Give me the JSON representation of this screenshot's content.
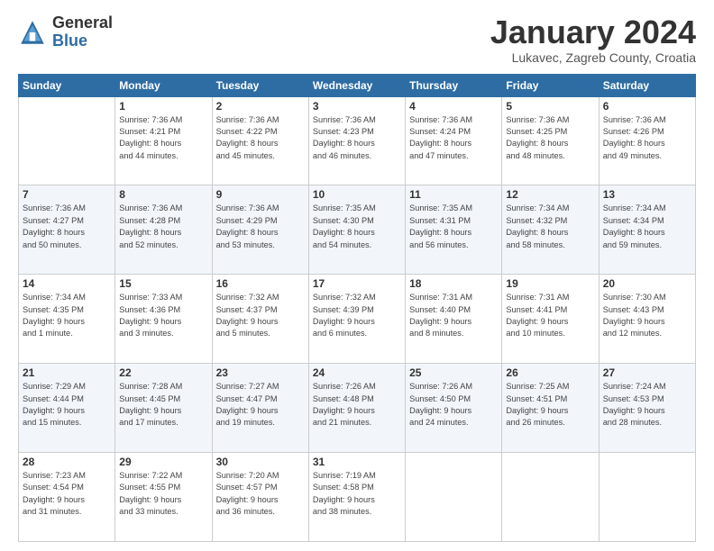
{
  "header": {
    "logo_general": "General",
    "logo_blue": "Blue",
    "month": "January 2024",
    "location": "Lukavec, Zagreb County, Croatia"
  },
  "weekdays": [
    "Sunday",
    "Monday",
    "Tuesday",
    "Wednesday",
    "Thursday",
    "Friday",
    "Saturday"
  ],
  "weeks": [
    [
      {
        "day": "",
        "info": ""
      },
      {
        "day": "1",
        "info": "Sunrise: 7:36 AM\nSunset: 4:21 PM\nDaylight: 8 hours\nand 44 minutes."
      },
      {
        "day": "2",
        "info": "Sunrise: 7:36 AM\nSunset: 4:22 PM\nDaylight: 8 hours\nand 45 minutes."
      },
      {
        "day": "3",
        "info": "Sunrise: 7:36 AM\nSunset: 4:23 PM\nDaylight: 8 hours\nand 46 minutes."
      },
      {
        "day": "4",
        "info": "Sunrise: 7:36 AM\nSunset: 4:24 PM\nDaylight: 8 hours\nand 47 minutes."
      },
      {
        "day": "5",
        "info": "Sunrise: 7:36 AM\nSunset: 4:25 PM\nDaylight: 8 hours\nand 48 minutes."
      },
      {
        "day": "6",
        "info": "Sunrise: 7:36 AM\nSunset: 4:26 PM\nDaylight: 8 hours\nand 49 minutes."
      }
    ],
    [
      {
        "day": "7",
        "info": "Sunrise: 7:36 AM\nSunset: 4:27 PM\nDaylight: 8 hours\nand 50 minutes."
      },
      {
        "day": "8",
        "info": "Sunrise: 7:36 AM\nSunset: 4:28 PM\nDaylight: 8 hours\nand 52 minutes."
      },
      {
        "day": "9",
        "info": "Sunrise: 7:36 AM\nSunset: 4:29 PM\nDaylight: 8 hours\nand 53 minutes."
      },
      {
        "day": "10",
        "info": "Sunrise: 7:35 AM\nSunset: 4:30 PM\nDaylight: 8 hours\nand 54 minutes."
      },
      {
        "day": "11",
        "info": "Sunrise: 7:35 AM\nSunset: 4:31 PM\nDaylight: 8 hours\nand 56 minutes."
      },
      {
        "day": "12",
        "info": "Sunrise: 7:34 AM\nSunset: 4:32 PM\nDaylight: 8 hours\nand 58 minutes."
      },
      {
        "day": "13",
        "info": "Sunrise: 7:34 AM\nSunset: 4:34 PM\nDaylight: 8 hours\nand 59 minutes."
      }
    ],
    [
      {
        "day": "14",
        "info": "Sunrise: 7:34 AM\nSunset: 4:35 PM\nDaylight: 9 hours\nand 1 minute."
      },
      {
        "day": "15",
        "info": "Sunrise: 7:33 AM\nSunset: 4:36 PM\nDaylight: 9 hours\nand 3 minutes."
      },
      {
        "day": "16",
        "info": "Sunrise: 7:32 AM\nSunset: 4:37 PM\nDaylight: 9 hours\nand 5 minutes."
      },
      {
        "day": "17",
        "info": "Sunrise: 7:32 AM\nSunset: 4:39 PM\nDaylight: 9 hours\nand 6 minutes."
      },
      {
        "day": "18",
        "info": "Sunrise: 7:31 AM\nSunset: 4:40 PM\nDaylight: 9 hours\nand 8 minutes."
      },
      {
        "day": "19",
        "info": "Sunrise: 7:31 AM\nSunset: 4:41 PM\nDaylight: 9 hours\nand 10 minutes."
      },
      {
        "day": "20",
        "info": "Sunrise: 7:30 AM\nSunset: 4:43 PM\nDaylight: 9 hours\nand 12 minutes."
      }
    ],
    [
      {
        "day": "21",
        "info": "Sunrise: 7:29 AM\nSunset: 4:44 PM\nDaylight: 9 hours\nand 15 minutes."
      },
      {
        "day": "22",
        "info": "Sunrise: 7:28 AM\nSunset: 4:45 PM\nDaylight: 9 hours\nand 17 minutes."
      },
      {
        "day": "23",
        "info": "Sunrise: 7:27 AM\nSunset: 4:47 PM\nDaylight: 9 hours\nand 19 minutes."
      },
      {
        "day": "24",
        "info": "Sunrise: 7:26 AM\nSunset: 4:48 PM\nDaylight: 9 hours\nand 21 minutes."
      },
      {
        "day": "25",
        "info": "Sunrise: 7:26 AM\nSunset: 4:50 PM\nDaylight: 9 hours\nand 24 minutes."
      },
      {
        "day": "26",
        "info": "Sunrise: 7:25 AM\nSunset: 4:51 PM\nDaylight: 9 hours\nand 26 minutes."
      },
      {
        "day": "27",
        "info": "Sunrise: 7:24 AM\nSunset: 4:53 PM\nDaylight: 9 hours\nand 28 minutes."
      }
    ],
    [
      {
        "day": "28",
        "info": "Sunrise: 7:23 AM\nSunset: 4:54 PM\nDaylight: 9 hours\nand 31 minutes."
      },
      {
        "day": "29",
        "info": "Sunrise: 7:22 AM\nSunset: 4:55 PM\nDaylight: 9 hours\nand 33 minutes."
      },
      {
        "day": "30",
        "info": "Sunrise: 7:20 AM\nSunset: 4:57 PM\nDaylight: 9 hours\nand 36 minutes."
      },
      {
        "day": "31",
        "info": "Sunrise: 7:19 AM\nSunset: 4:58 PM\nDaylight: 9 hours\nand 38 minutes."
      },
      {
        "day": "",
        "info": ""
      },
      {
        "day": "",
        "info": ""
      },
      {
        "day": "",
        "info": ""
      }
    ]
  ]
}
